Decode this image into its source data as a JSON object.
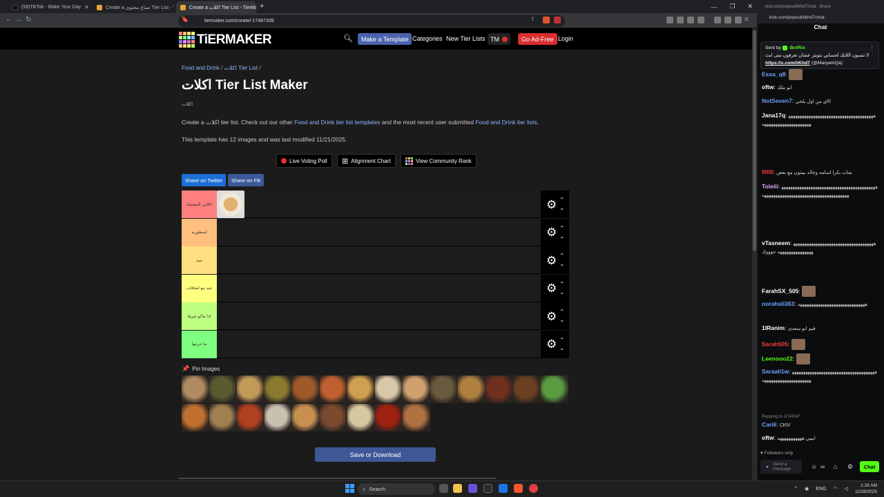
{
  "browser": {
    "tabs": [
      {
        "label": "(58)TikTok - Make Your Day"
      },
      {
        "label": "Create a صناع محتوى Tier List - TierM..."
      },
      {
        "label": "Create a اكلات Tier List - TierMa..."
      }
    ],
    "url": "tiermaker.com/create/-17487339",
    "new_tab": "+",
    "window_controls": [
      "—",
      "❐",
      "✕"
    ]
  },
  "site": {
    "logo_text": "TiERMAKER",
    "nav": {
      "make_template": "Make a Template",
      "categories": "Categories",
      "new_tier_lists": "New Tier Lists",
      "tm": "TM",
      "go_ad_free": "Go Ad-Free",
      "login": "Login"
    }
  },
  "page": {
    "breadcrumb": {
      "category": "Food and Drink",
      "sep1": "/",
      "item": "اكلات Tier List",
      "sep2": "/"
    },
    "title": "اكلات Tier List Maker",
    "subtitle": "اكلات",
    "description": {
      "part1": "Create a اكلات tier list. Check out our other ",
      "link1": "Food and Drink tier list templates",
      "part2": " and the most recent user submitted ",
      "link2": "Food and Drink tier lists",
      "part3": "."
    },
    "modified": "This template has 12 images and was last modified 11/21/2025.",
    "buttons": {
      "voting": "Live Voting Poll",
      "alignment": "Alignment Chart",
      "community": "View Community Rank",
      "twitter": "Share on Twitter",
      "fb": "Share on FB",
      "save": "Save or Download"
    },
    "pin_label": "Pin Images"
  },
  "tiers": [
    {
      "label": "اكلاتي المفضلة",
      "color": "#ff7f7f"
    },
    {
      "label": "اسطوريه",
      "color": "#ffbf7f"
    },
    {
      "label": "جيد",
      "color": "#ffdf7f"
    },
    {
      "label": "جيد مع اضافات",
      "color": "#ffff7f"
    },
    {
      "label": "اذا ماكو غيرها",
      "color": "#bfff7f"
    },
    {
      "label": "ما جربتها",
      "color": "#7fff7f"
    }
  ],
  "tier_controls": {
    "gear": "⚙",
    "up": "⌃",
    "down": "⌄"
  },
  "pool_images": [
    {
      "name": "wraps",
      "color": "#b08a60"
    },
    {
      "name": "dolma",
      "color": "#5a5a30"
    },
    {
      "name": "rice-plate",
      "color": "#c49a5a"
    },
    {
      "name": "soup",
      "color": "#8a7a30"
    },
    {
      "name": "kubba",
      "color": "#a05a2a"
    },
    {
      "name": "burger",
      "color": "#c06030"
    },
    {
      "name": "pasta",
      "color": "#d0a050"
    },
    {
      "name": "sandwich",
      "color": "#d8c8a8"
    },
    {
      "name": "fries",
      "color": "#d0a070"
    },
    {
      "name": "stew",
      "color": "#6a5a40"
    },
    {
      "name": "biryani",
      "color": "#b08040"
    },
    {
      "name": "meat-stew",
      "color": "#703020"
    },
    {
      "name": "kebab",
      "color": "#6a4020"
    },
    {
      "name": "salad",
      "color": "#5a9a40"
    },
    {
      "name": "lasagna",
      "color": "#c07030"
    },
    {
      "name": "noodles",
      "color": "#a08050"
    },
    {
      "name": "shawarma",
      "color": "#b04020"
    },
    {
      "name": "sushi",
      "color": "#c8c0b0"
    },
    {
      "name": "rolls",
      "color": "#c89050"
    },
    {
      "name": "cake",
      "color": "#7a4a30"
    },
    {
      "name": "spaghetti",
      "color": "#d8c8a0"
    },
    {
      "name": "wings",
      "color": "#a02010"
    },
    {
      "name": "burger2",
      "color": "#b07040"
    }
  ],
  "taskbar": {
    "search": "Search",
    "lang": "ENG",
    "time": "1:28 AM",
    "date": "11/28/2025"
  },
  "chat": {
    "url_top": "kick.com/popout/iikhd7/chat - Brave",
    "url": "kick.com/popout/iikhd7/chat",
    "title": "Chat",
    "pinned": {
      "sent_by": "Sent by",
      "bot": "BotRix",
      "text": "لا تنسون اللايك لحسابي بتويتر عشان تعرفون متى ابث",
      "link": "https://x.com/iiKhd7",
      "handle": "(@MaryamQa)"
    },
    "messages": [
      {
        "user": "Essa_q8",
        "color": "#6fa0ff",
        "body": ""
      },
      {
        "user": "oftw",
        "color": "#fff",
        "body": "ابو ملك"
      },
      {
        "user": "NotSeven7",
        "color": "#6fa0ff",
        "body": "اااي من اول يلخي"
      },
      {
        "user": "Jana17q",
        "color": "#fff",
        "body": "ههههههههههههههههههههههههههههههههههههههههههههههههههههههههههههه"
      },
      {
        "user": "l0llll",
        "color": "#ff3b3b",
        "body": "شات بكرا اسامه وخالد بيبثون مع بعض"
      },
      {
        "user": "Toleiii",
        "color": "#e0aaff",
        "body": "هههههههههههههههههههههههههههههههههههههههههههههههههههههههههههههههههههههههههههههههههه"
      },
      {
        "user": "vTasneem",
        "color": "#fff",
        "body": "ههههههههههههههههههههههههههههههههههههههههههههههههههههه جوووك"
      },
      {
        "user": "FarahSX_505",
        "color": "#fff",
        "body": ""
      },
      {
        "user": "norahali363",
        "color": "#6fa0ff",
        "body": "ههههههههههههههههههههههههههههههه"
      },
      {
        "user": "1lRanim",
        "color": "#fff",
        "body": "قيم ابو سعدى"
      },
      {
        "user": "Sarah505",
        "color": "#ff3b3b",
        "body": ""
      },
      {
        "user": "Leenooo22",
        "color": "#53fc18",
        "body": ""
      },
      {
        "user": "Saraali1w",
        "color": "#6fa0ff",
        "body": "هههههههههههههههههههههههههههههههههههههههههههههههههههههههههههه"
      },
      {
        "user": "Cari6",
        "color": "#6fa0ff",
        "body": "CKIV",
        "reply": "Replying to 1lTARAF"
      },
      {
        "user": "oftw",
        "color": "#fff",
        "body": "ابيبي هههههههههههه"
      }
    ],
    "followers_only": "Followers only",
    "input_placeholder": "Send a message",
    "chat_button": "Chat"
  }
}
